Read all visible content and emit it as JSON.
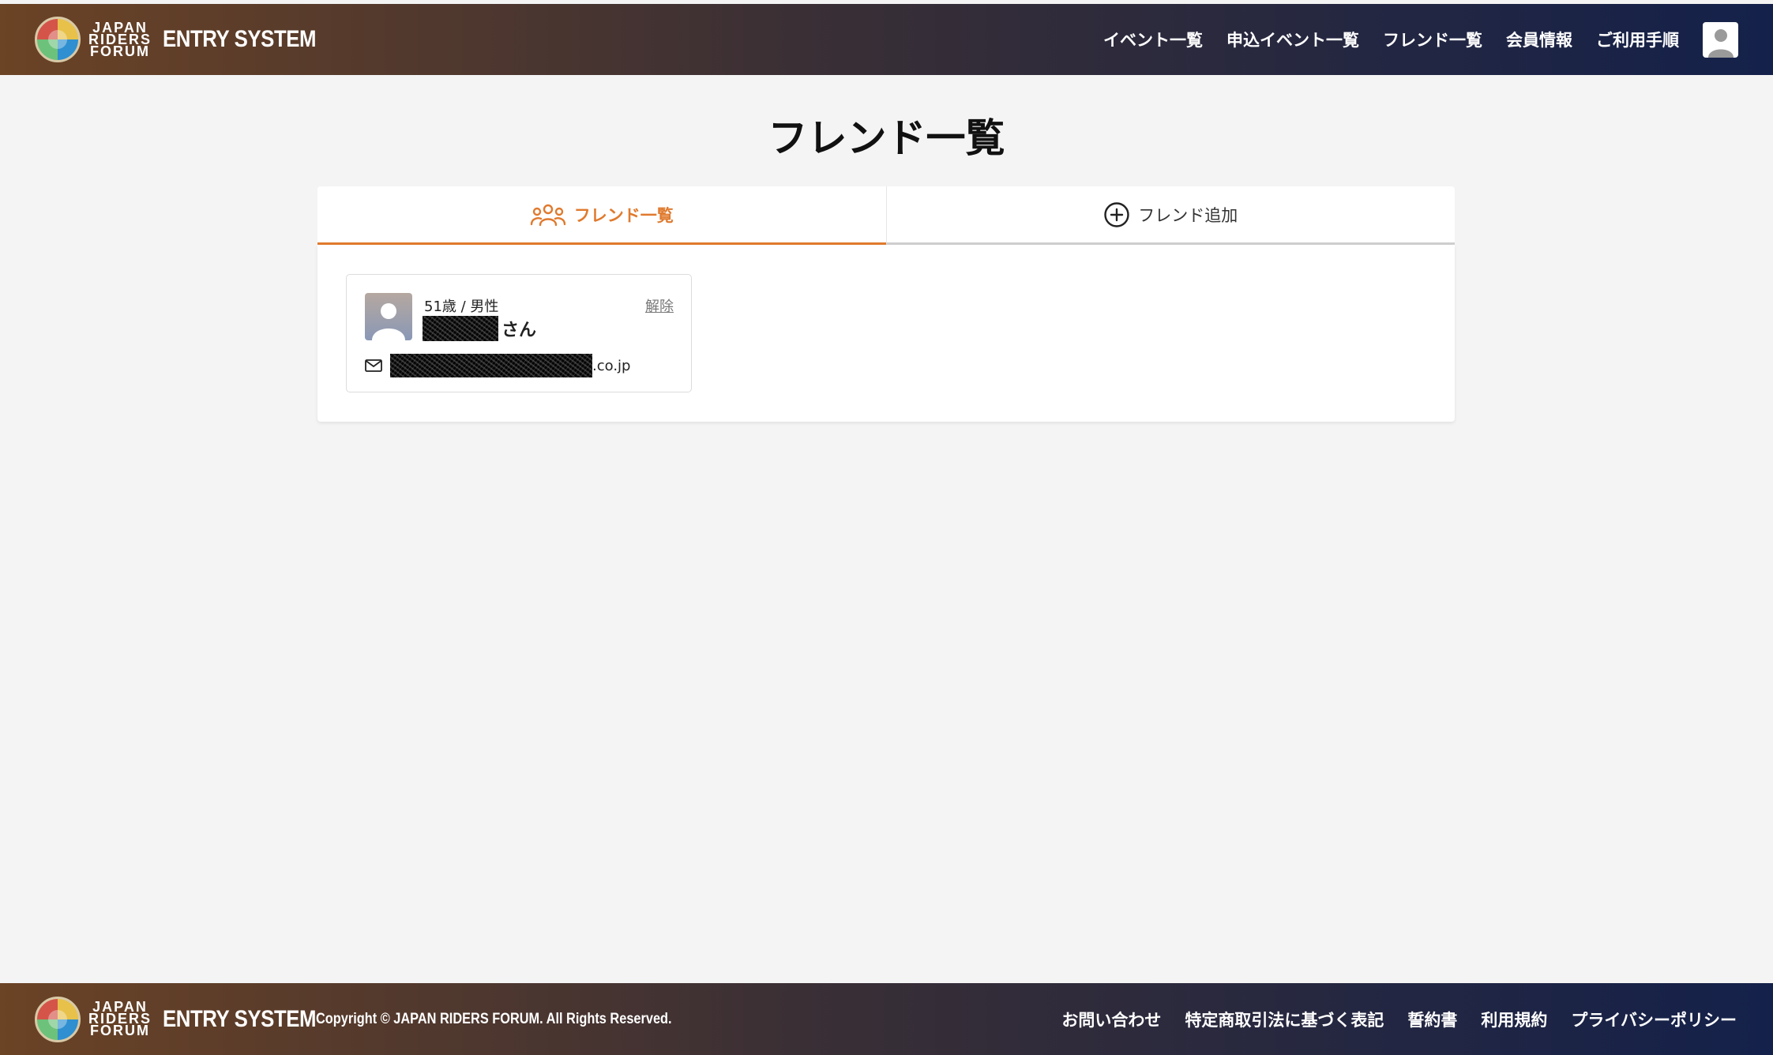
{
  "brand": {
    "logo_lines": [
      "JAPAN",
      "RIDERS",
      "FORUM"
    ],
    "system_name": "ENTRY SYSTEM"
  },
  "header": {
    "nav": [
      {
        "label": "イベント一覧"
      },
      {
        "label": "申込イベント一覧"
      },
      {
        "label": "フレンド一覧"
      },
      {
        "label": "会員情報"
      },
      {
        "label": "ご利用手順"
      }
    ],
    "avatar_icon": "user-avatar-icon"
  },
  "page": {
    "title": "フレンド一覧"
  },
  "tabs": [
    {
      "label": "フレンド一覧",
      "icon": "users-icon",
      "active": true
    },
    {
      "label": "フレンド追加",
      "icon": "plus-circle-icon",
      "active": false
    }
  ],
  "friends": [
    {
      "meta": "51歳 / 男性",
      "name_suffix": "さん",
      "email_suffix": ".co.jp",
      "remove_label": "解除"
    }
  ],
  "footer": {
    "copyright": "Copyright © JAPAN RIDERS FORUM. All Rights Reserved.",
    "links": [
      {
        "label": "お問い合わせ"
      },
      {
        "label": "特定商取引法に基づく表記"
      },
      {
        "label": "誓約書"
      },
      {
        "label": "利用規約"
      },
      {
        "label": "プライバシーポリシー"
      }
    ]
  },
  "colors": {
    "accent": "#e07a2e",
    "header_gradient_start": "#6b4325",
    "header_gradient_end": "#14214a",
    "background": "#f4f4f4"
  }
}
